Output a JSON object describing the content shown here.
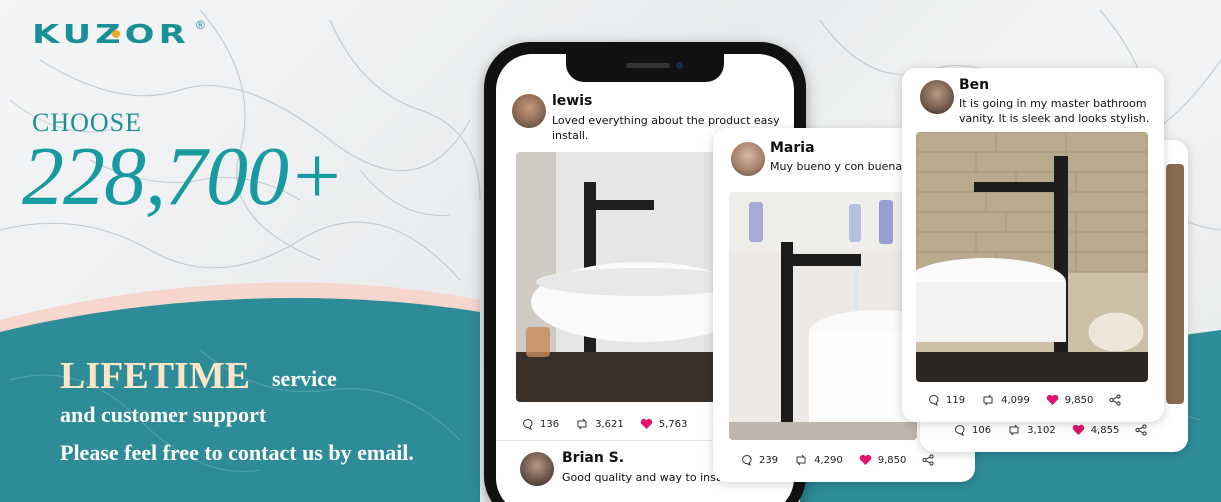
{
  "logo": {
    "text": "KUZOR",
    "reg": "®"
  },
  "headline": {
    "choose": "CHOOSE",
    "number": "228,700+"
  },
  "service": {
    "lifetime": "LIFETIME",
    "service_word": "service",
    "support": "and customer support",
    "contact": "Please feel free to contact us by email."
  },
  "reviews": [
    {
      "name": "lewis",
      "comment": "Loved everything about the product easy install.",
      "comments": "136",
      "reposts": "3,621",
      "likes": "5,763"
    },
    {
      "name": "Brian S.",
      "comment": "Good quality and way to install"
    },
    {
      "name": "Maria",
      "comment": "Muy bueno y con buena c",
      "comments": "239",
      "reposts": "4,290",
      "likes": "9,850"
    },
    {
      "name": "Ben",
      "comment": "It is going in my master bathroom vanity. It is sleek and looks stylish.",
      "comments": "119",
      "reposts": "4,099",
      "likes": "9,850"
    },
    {
      "comments": "106",
      "reposts": "3,102",
      "likes": "4,855"
    }
  ],
  "colors": {
    "teal": "#1c8e95",
    "accent": "#fbe6c8",
    "like": "#e0126b"
  }
}
